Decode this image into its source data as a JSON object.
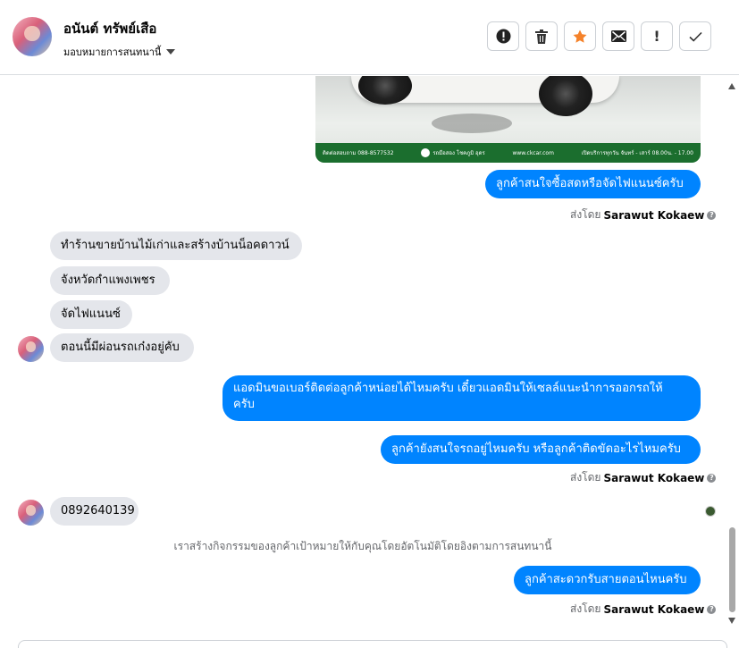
{
  "header": {
    "name": "อนันต์ ทรัพย์เสือ",
    "assign_label": "มอบหมายการสนทนานี้",
    "toolbar_icons": [
      "alert-circle-icon",
      "trash-icon",
      "star-icon",
      "envelope-icon",
      "exclamation-icon",
      "check-icon"
    ],
    "star_color": "#f5822a"
  },
  "image_message": {
    "band_left": "ติดต่อสอบถาม 088-8577532",
    "band_mid": "รถมือสอง โชคภูมิ อุดร",
    "band_right": "www.ckcar.com",
    "band_hours": "เปิดบริการทุกวัน จันทร์ - เสาร์ 08.00น. - 17.00"
  },
  "messages": [
    {
      "id": "m1",
      "dir": "out",
      "text": "ลูกค้าสนใจซื้อสดหรือจัดไฟแนนซ์ครับ"
    },
    {
      "id": "m2",
      "dir": "in",
      "text": "ทำร้านขายบ้านไม้เก่าและสร้างบ้านน็อคดาวน์"
    },
    {
      "id": "m3",
      "dir": "in",
      "text": "จังหวัดกำแพงเพชร"
    },
    {
      "id": "m4",
      "dir": "in",
      "text": "จัดไฟแนนซ์"
    },
    {
      "id": "m5",
      "dir": "in",
      "text": "ตอนนี้มีผ่อนรถเก๋งอยู่คับ"
    },
    {
      "id": "m6",
      "dir": "out",
      "line1": "แอดมินขอเบอร์ติดต่อลูกค้าหน่อยได้ไหมครับ เดี๋ยวแอดมินให้เซลล์แนะนำการออกรถให้",
      "line2": "ครับ"
    },
    {
      "id": "m7",
      "dir": "out",
      "text": "ลูกค้ายังสนใจรถอยู่ไหมครับ หรือลูกค้าติดขัดอะไรไหมครับ"
    },
    {
      "id": "m8",
      "dir": "in",
      "text": "0892640139"
    },
    {
      "id": "m9",
      "dir": "out",
      "text": "ลูกค้าสะดวกรับสายตอนไหนครับ"
    }
  ],
  "sent_by": {
    "prefix": "ส่งโดย",
    "name": "Sarawut Kokaew"
  },
  "system_note": "เราสร้างกิจกรรมของลูกค้าเป้าหมายให้กับคุณโดยอัตโนมัติโดยอิงตามการสนทนานี้",
  "colors": {
    "outgoing": "#0084ff",
    "incoming": "#e4e6eb",
    "meta": "#65676b"
  }
}
